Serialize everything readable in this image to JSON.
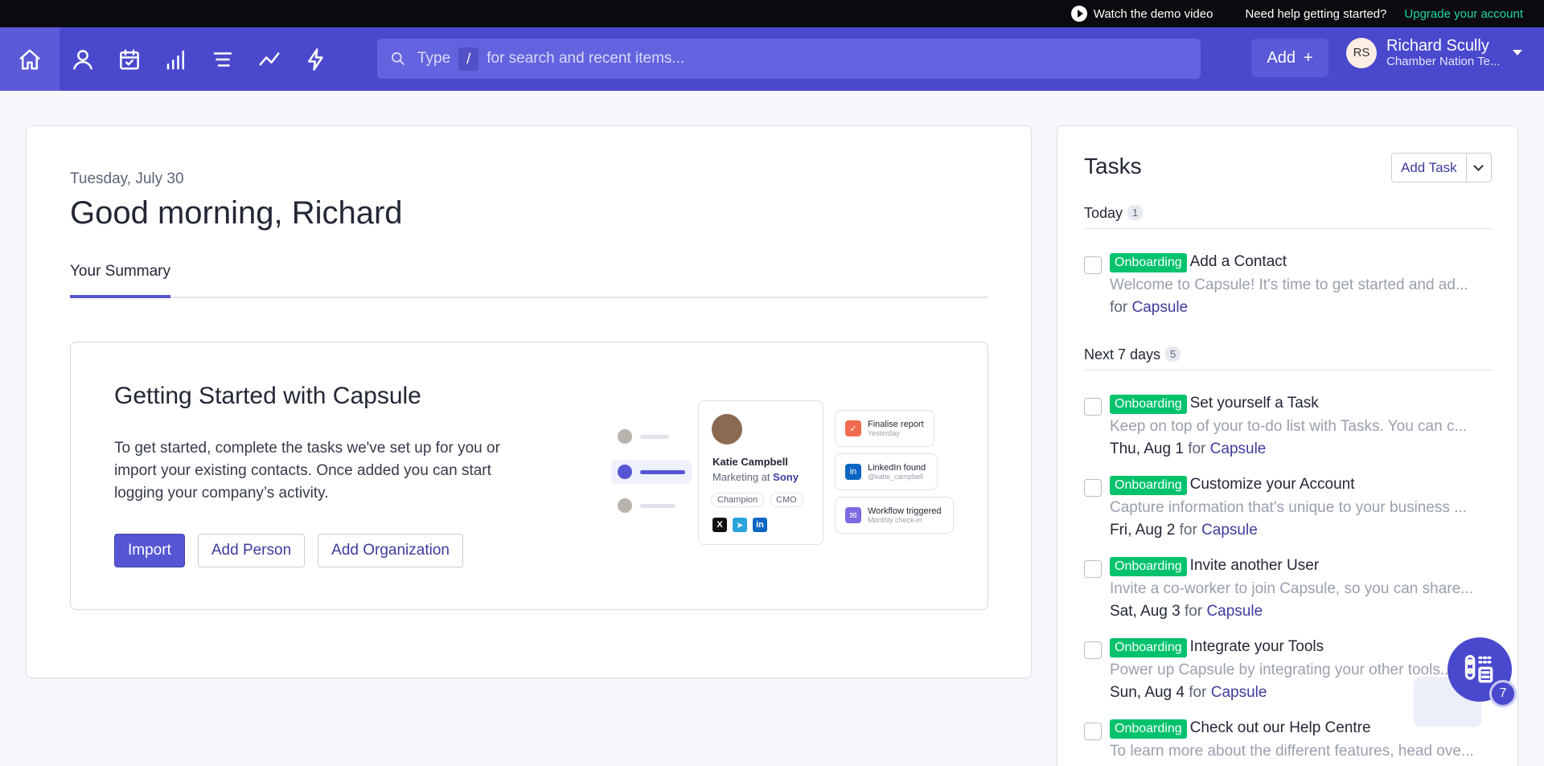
{
  "topbar": {
    "demo_label": "Watch the demo video",
    "help_label": "Need help getting started?",
    "upgrade_label": "Upgrade your account"
  },
  "nav": {
    "icons": [
      "home-icon",
      "person-icon",
      "calendar-icon",
      "bar-chart-icon",
      "list-icon",
      "trend-line-icon",
      "lightning-icon"
    ],
    "search": {
      "type_label": "Type",
      "slash": "/",
      "hint": "for search and recent items..."
    },
    "add_label": "Add",
    "user": {
      "initials": "RS",
      "name": "Richard Scully",
      "org": "Chamber Nation Te..."
    }
  },
  "main": {
    "date": "Tuesday, July 30",
    "greeting": "Good morning, Richard",
    "tab": "Your Summary",
    "getting_started": {
      "title": "Getting Started with Capsule",
      "text": "To get started, complete the tasks we've set up for you or import your existing contacts. Once added you can start logging your company’s activity.",
      "buttons": {
        "import": "Import",
        "add_person": "Add Person",
        "add_org": "Add Organization"
      },
      "illustration": {
        "name": "Katie Campbell",
        "role_prefix": "Marketing at",
        "company": "Sony",
        "chips": [
          "Champion",
          "CMO"
        ],
        "notifications": [
          {
            "title": "Finalise report",
            "sub": "Yesterday"
          },
          {
            "title": "LinkedIn found",
            "sub": "@katie_campbell"
          },
          {
            "title": "Workflow triggered",
            "sub": "Monthly check-in"
          }
        ]
      }
    }
  },
  "tasks": {
    "title": "Tasks",
    "add_task_label": "Add Task",
    "today_label": "Today",
    "today_count": "1",
    "next_label": "Next 7 days",
    "next_count": "5",
    "badge": "Onboarding",
    "for_label": "for",
    "items": [
      {
        "title": "Add a Contact",
        "desc": "Welcome to Capsule! It's time to get started and ad...",
        "date": "",
        "link": "Capsule"
      },
      {
        "title": "Set yourself a Task",
        "desc": "Keep on top of your to-do list with Tasks. You can c...",
        "date": "Thu, Aug 1",
        "link": "Capsule"
      },
      {
        "title": "Customize your Account",
        "desc": "Capture information that's unique to your business ...",
        "date": "Fri, Aug 2",
        "link": "Capsule"
      },
      {
        "title": "Invite another User",
        "desc": "Invite a co-worker to join Capsule, so you can share...",
        "date": "Sat, Aug 3",
        "link": "Capsule"
      },
      {
        "title": "Integrate your Tools",
        "desc": "Power up Capsule by integrating your other tools...",
        "date": "Sun, Aug 4",
        "link": "Capsule"
      },
      {
        "title": "Check out our Help Centre",
        "desc": "To learn more about the different features, head ove...",
        "date": "",
        "link": ""
      }
    ]
  },
  "fab": {
    "count": "7"
  },
  "colors": {
    "brand": "#4a49cd",
    "badge": "#00c26c",
    "link": "#3d3c9e",
    "upgrade": "#1fd79a"
  }
}
